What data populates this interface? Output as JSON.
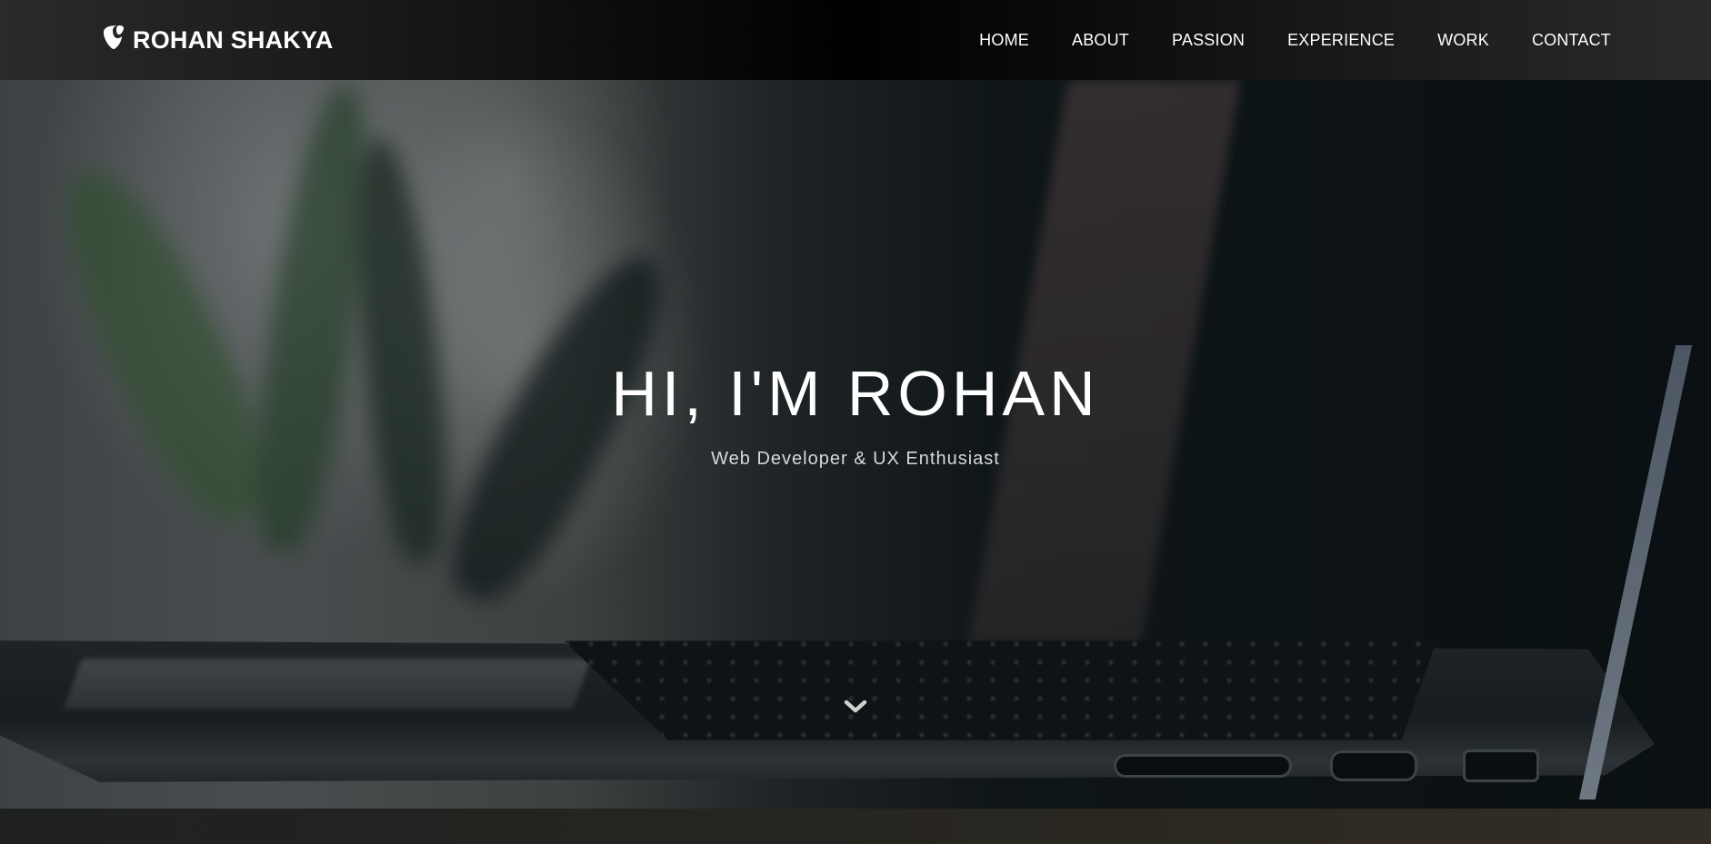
{
  "navbar": {
    "brand": {
      "icon": "typo3-logo-icon",
      "name": "ROHAN SHAKYA"
    },
    "links": [
      {
        "label": "HOME"
      },
      {
        "label": "ABOUT"
      },
      {
        "label": "PASSION"
      },
      {
        "label": "EXPERIENCE"
      },
      {
        "label": "WORK"
      },
      {
        "label": "CONTACT"
      }
    ]
  },
  "hero": {
    "title": "HI, I'M ROHAN",
    "subtitle": "Web Developer & UX Enthusiast",
    "scroll_icon": "chevron-down-icon"
  },
  "colors": {
    "nav_text": "#ffffff",
    "title_text": "#ffffff",
    "subtitle_text": "#d8d8d8"
  }
}
